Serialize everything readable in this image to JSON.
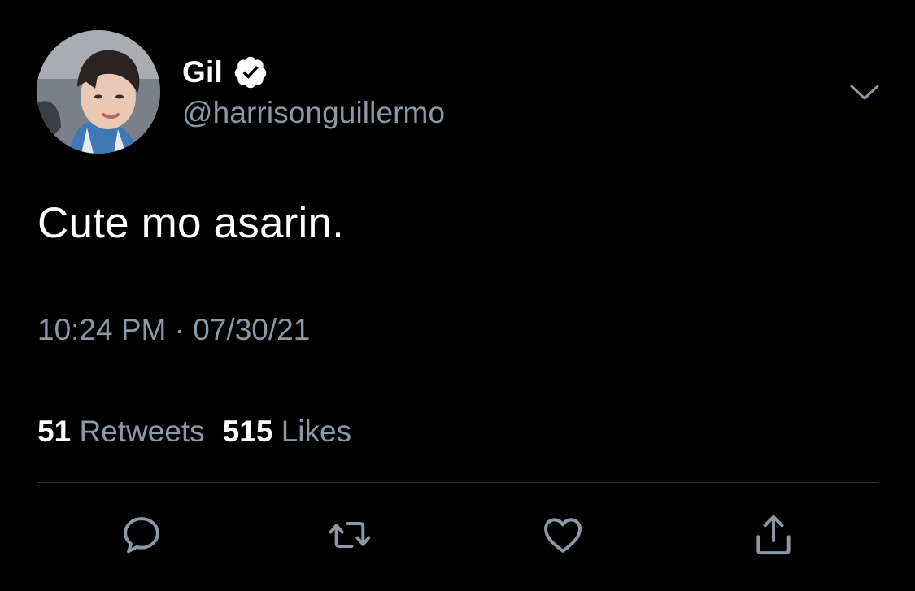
{
  "user": {
    "display_name": "Gil",
    "handle": "@harrisonguillermo",
    "avatar_icon": "profile-photo",
    "verified_icon": "verified-badge-icon"
  },
  "tweet": {
    "text": "Cute mo asarin.",
    "time": "10:24 PM",
    "separator": " · ",
    "date": "07/30/21"
  },
  "stats": {
    "retweets_count": "51",
    "retweets_label": "Retweets",
    "likes_count": "515",
    "likes_label": "Likes"
  },
  "actions": {
    "reply_icon": "reply-icon",
    "retweet_icon": "retweet-icon",
    "like_icon": "heart-icon",
    "share_icon": "share-icon",
    "more_icon": "chevron-down-icon"
  },
  "colors": {
    "background": "#000000",
    "text_primary": "#ffffff",
    "text_secondary": "#8b98a5",
    "divider": "#2f3336",
    "icon": "#8b98a5"
  }
}
